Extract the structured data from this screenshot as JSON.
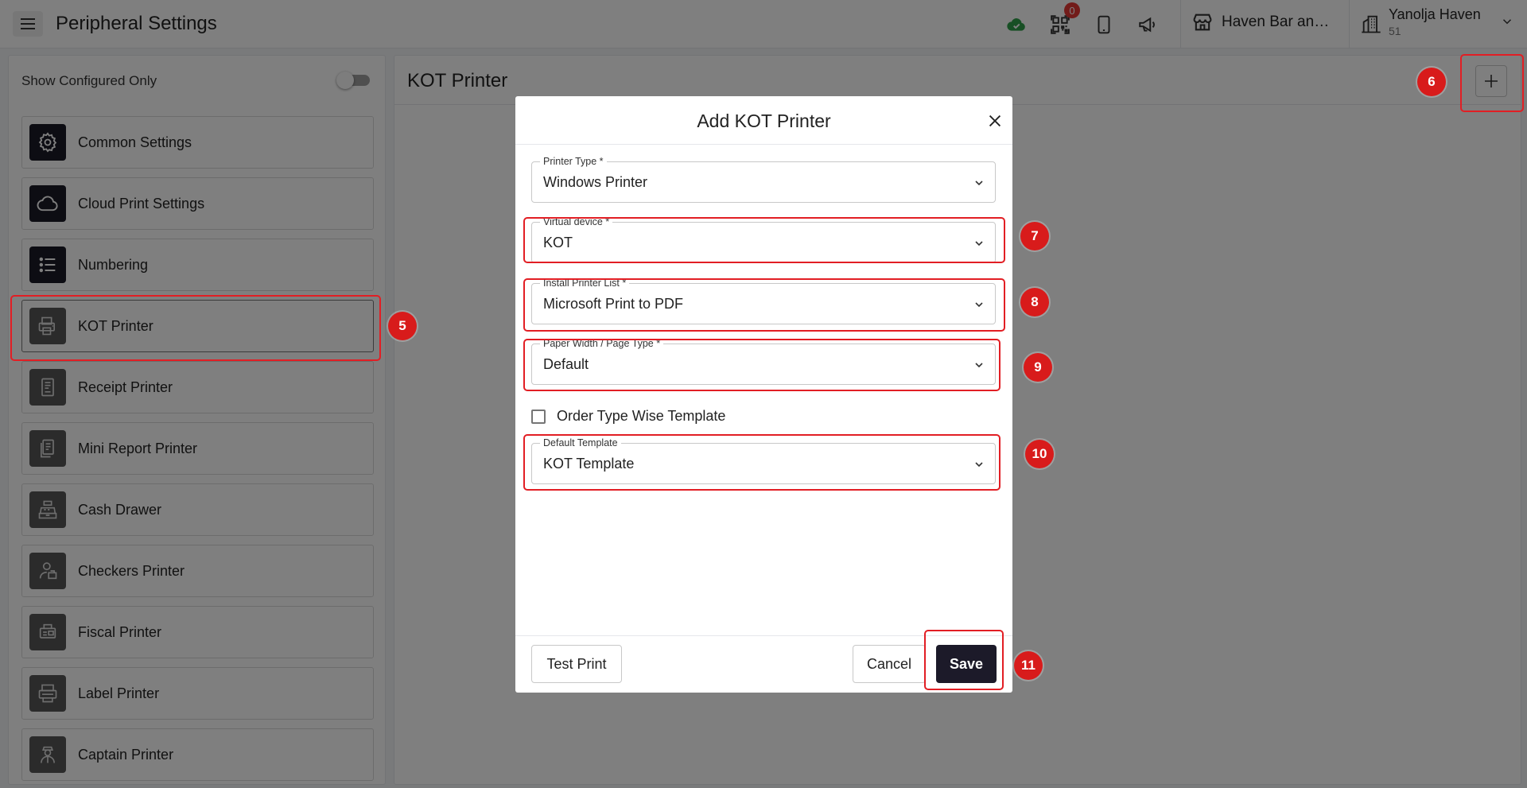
{
  "header": {
    "title": "Peripheral Settings",
    "notification_count": "0",
    "store_name": "Haven Bar and R...",
    "user_name": "Yanolja Haven",
    "user_sub": "51"
  },
  "sidebar": {
    "show_configured_label": "Show Configured Only",
    "items": [
      {
        "label": "Common Settings",
        "icon": "gear-icon"
      },
      {
        "label": "Cloud Print Settings",
        "icon": "cloud-icon"
      },
      {
        "label": "Numbering",
        "icon": "list-icon"
      },
      {
        "label": "KOT Printer",
        "icon": "kot-printer-icon"
      },
      {
        "label": "Receipt Printer",
        "icon": "receipt-icon"
      },
      {
        "label": "Mini Report Printer",
        "icon": "report-icon"
      },
      {
        "label": "Cash Drawer",
        "icon": "cash-register-icon"
      },
      {
        "label": "Checkers Printer",
        "icon": "checker-icon"
      },
      {
        "label": "Fiscal Printer",
        "icon": "fiscal-printer-icon"
      },
      {
        "label": "Label Printer",
        "icon": "label-printer-icon"
      },
      {
        "label": "Captain Printer",
        "icon": "captain-icon"
      }
    ]
  },
  "main": {
    "title": "KOT Printer"
  },
  "modal": {
    "title": "Add KOT Printer",
    "fields": {
      "printer_type": {
        "label": "Printer Type *",
        "value": "Windows Printer"
      },
      "virtual_device": {
        "label": "Virtual device *",
        "value": "KOT"
      },
      "install_printer": {
        "label": "Install Printer List *",
        "value": "Microsoft Print to PDF"
      },
      "paper_width": {
        "label": "Paper Width / Page Type *",
        "value": "Default"
      },
      "default_template": {
        "label": "Default Template",
        "value": "KOT Template"
      }
    },
    "order_type_label": "Order Type Wise Template",
    "test_print_label": "Test Print",
    "cancel_label": "Cancel",
    "save_label": "Save"
  },
  "annotations": [
    "5",
    "6",
    "7",
    "8",
    "9",
    "10",
    "11"
  ],
  "colors": {
    "accent_dark": "#1c1a29",
    "annotation_red": "#d81b1b",
    "cloud_ok": "#2e9e48"
  }
}
